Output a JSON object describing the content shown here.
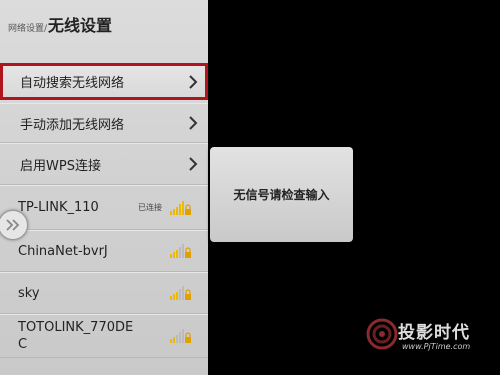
{
  "header": {
    "breadcrumb": "网络设置/",
    "title": "无线设置"
  },
  "menu": [
    {
      "label": "自动搜索无线网络"
    },
    {
      "label": "手动添加无线网络"
    },
    {
      "label": "启用WPS连接"
    }
  ],
  "networks": [
    {
      "name": "TP-LINK_110",
      "status": "已连接",
      "secured": true
    },
    {
      "name": "ChinaNet-bvrJ",
      "status": "",
      "secured": true
    },
    {
      "name": "sky",
      "status": "",
      "secured": true
    },
    {
      "name": "TOTOLINK_770DE\nC",
      "status": "",
      "secured": true
    }
  ],
  "popup": {
    "message": "无信号请检查输入"
  },
  "watermark": {
    "name": "投影时代",
    "url": "www.PjTime.com"
  },
  "colors": {
    "selection": "#b1151c",
    "signal": "#f0b800",
    "lock": "#e0a000"
  }
}
